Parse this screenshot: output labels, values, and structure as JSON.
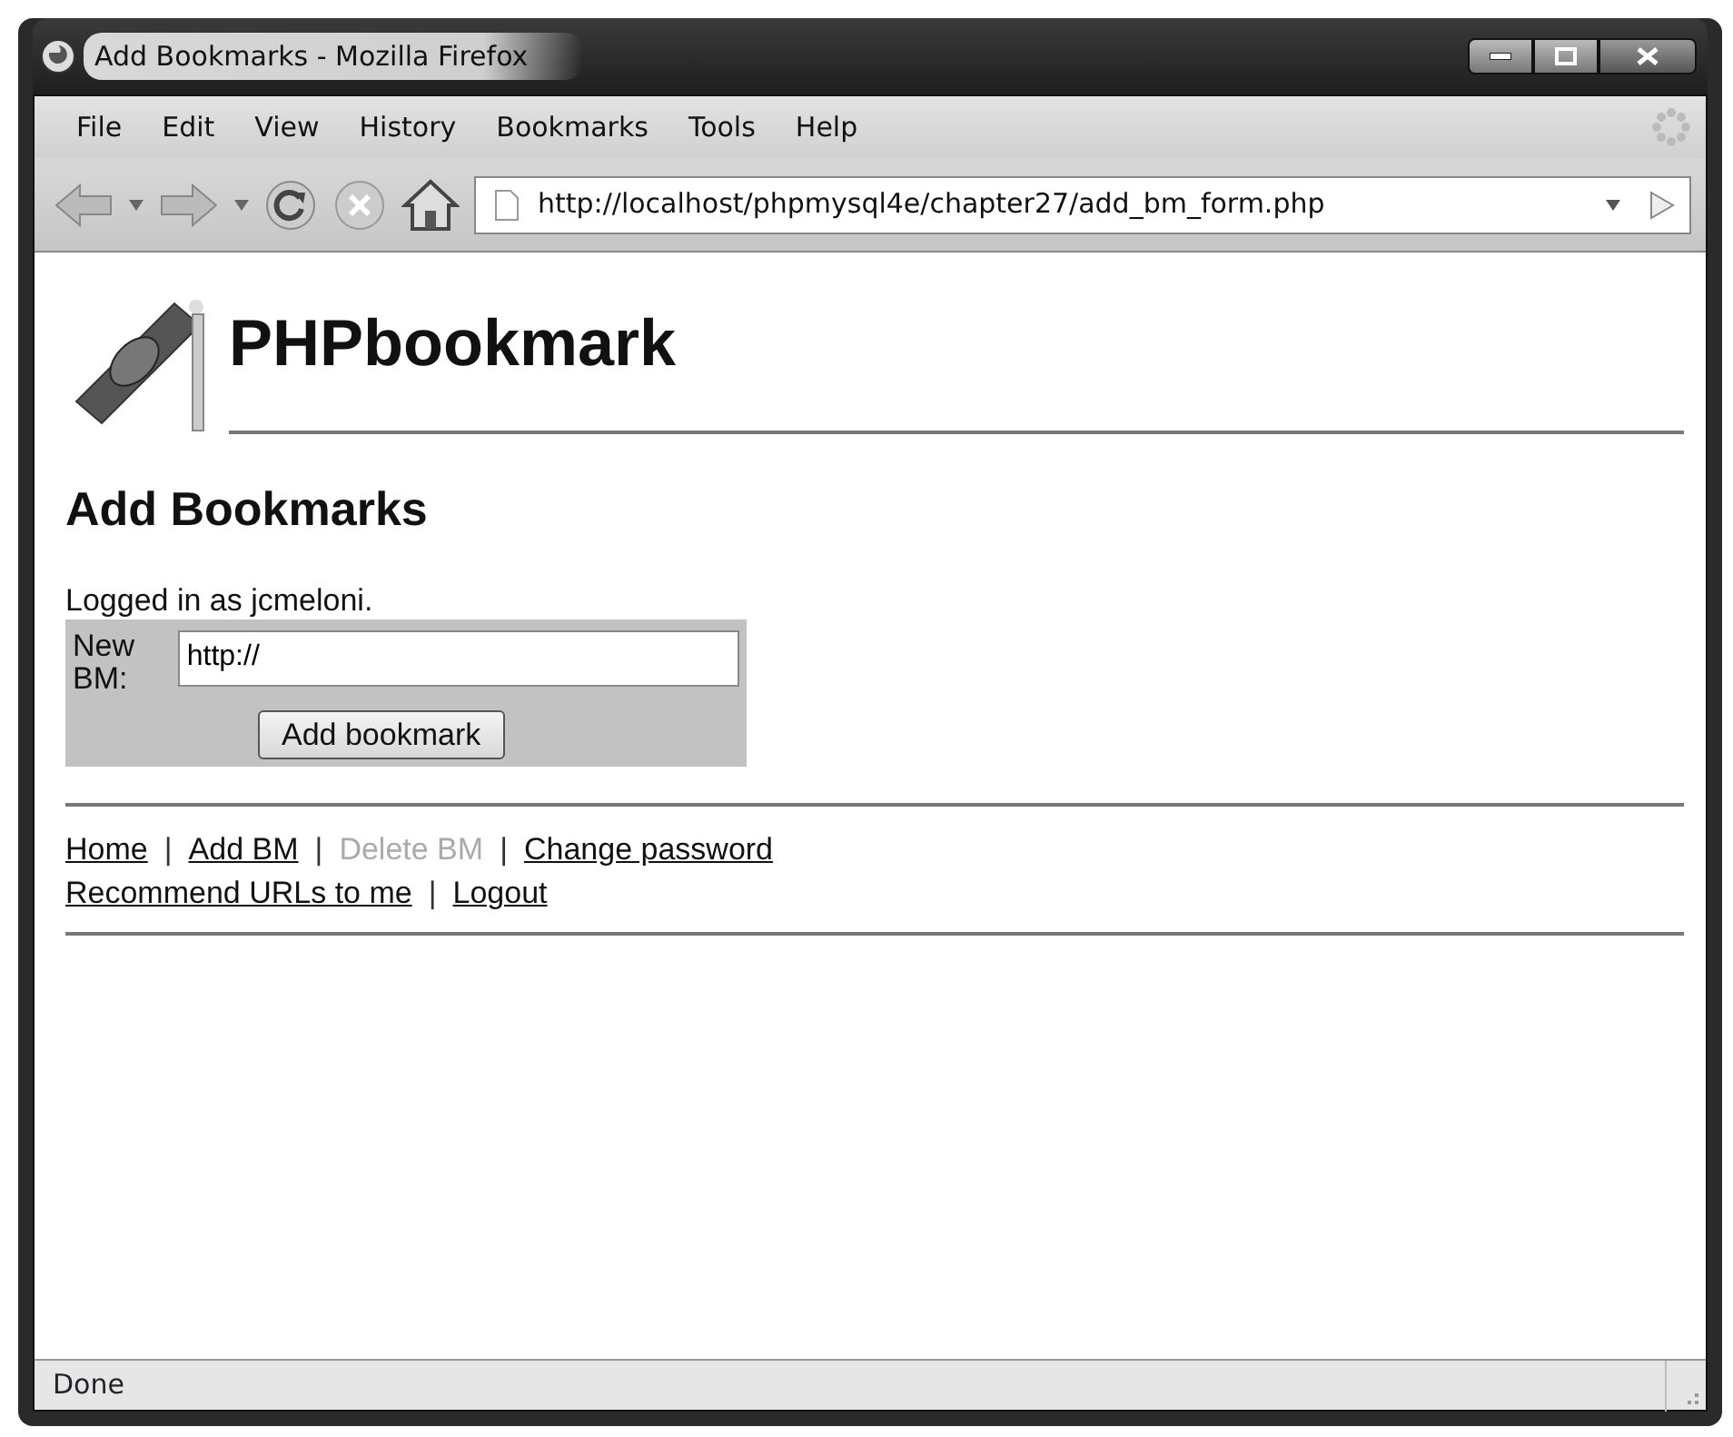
{
  "window": {
    "title": "Add Bookmarks - Mozilla Firefox"
  },
  "menu": [
    "File",
    "Edit",
    "View",
    "History",
    "Bookmarks",
    "Tools",
    "Help"
  ],
  "address_bar": {
    "url": "http://localhost/phpmysql4e/chapter27/add_bm_form.php"
  },
  "page": {
    "site_title": "PHPbookmark",
    "heading": "Add Bookmarks",
    "logged_in": "Logged in as jcmeloni.",
    "form": {
      "label": "New BM:",
      "value": "http://",
      "button": "Add bookmark"
    },
    "nav_rows": [
      [
        {
          "kind": "link",
          "text": "Home",
          "disabled": false
        },
        {
          "kind": "separator",
          "text": "|"
        },
        {
          "kind": "link",
          "text": "Add BM",
          "disabled": false
        },
        {
          "kind": "separator",
          "text": "|"
        },
        {
          "kind": "link",
          "text": "Delete BM",
          "disabled": true
        },
        {
          "kind": "separator",
          "text": "|"
        },
        {
          "kind": "link",
          "text": "Change password",
          "disabled": false
        }
      ],
      [
        {
          "kind": "link",
          "text": "Recommend URLs to me",
          "disabled": false
        },
        {
          "kind": "separator",
          "text": "|"
        },
        {
          "kind": "link",
          "text": "Logout",
          "disabled": false
        }
      ]
    ]
  },
  "status_bar": "Done"
}
